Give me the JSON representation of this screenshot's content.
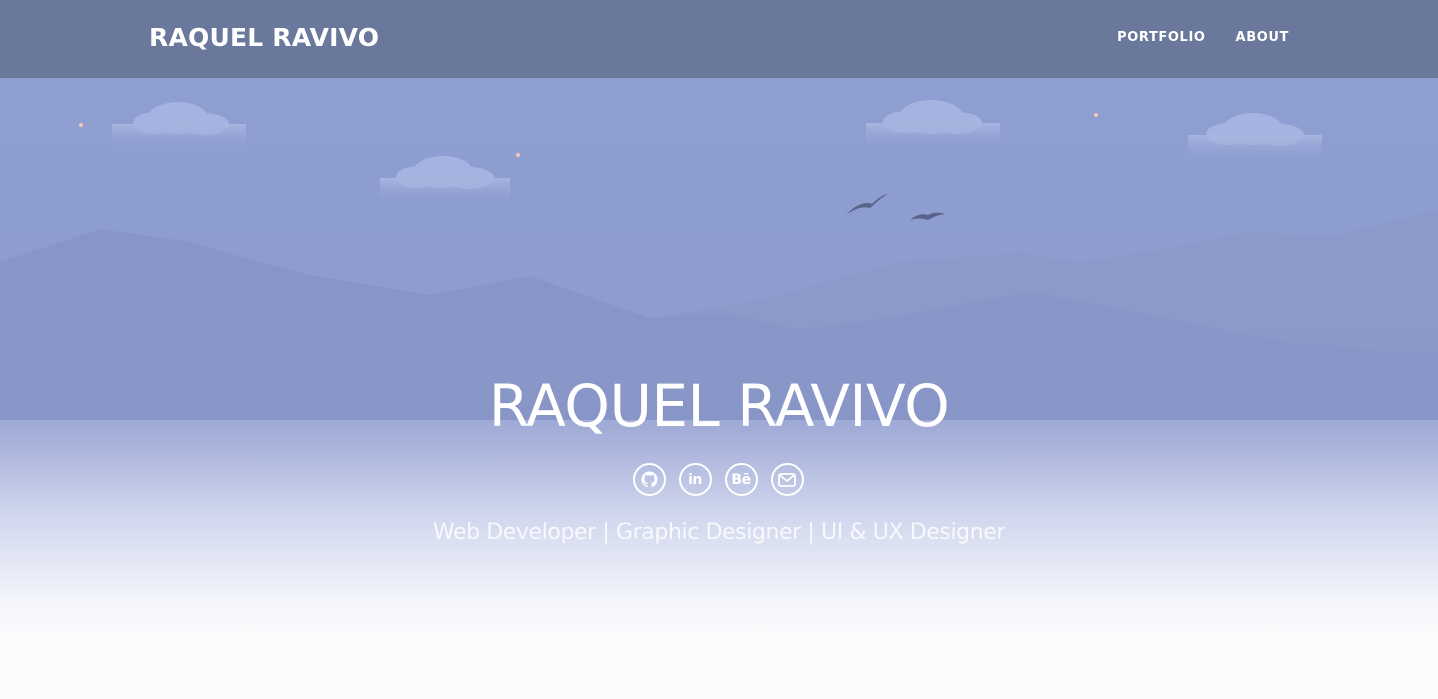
{
  "navbar": {
    "brand": "RAQUEL RAVIVO",
    "links": [
      {
        "label": "PORTFOLIO"
      },
      {
        "label": "ABOUT"
      }
    ]
  },
  "hero": {
    "title": "RAQUEL RAVIVO",
    "subtitle": "Web Developer | Graphic Designer | UI & UX Designer",
    "social": [
      {
        "icon": "github-icon"
      },
      {
        "icon": "linkedin-icon",
        "text": "in"
      },
      {
        "icon": "behance-icon",
        "text": "Bē"
      },
      {
        "icon": "email-icon"
      }
    ]
  },
  "colors": {
    "navbar_bg": "#6a789b",
    "sky": "#8f9fd1",
    "mountain_back": "#8897c8",
    "mountain_front": "#8493c4",
    "bird": "#5a6288",
    "text": "#ffffff"
  }
}
